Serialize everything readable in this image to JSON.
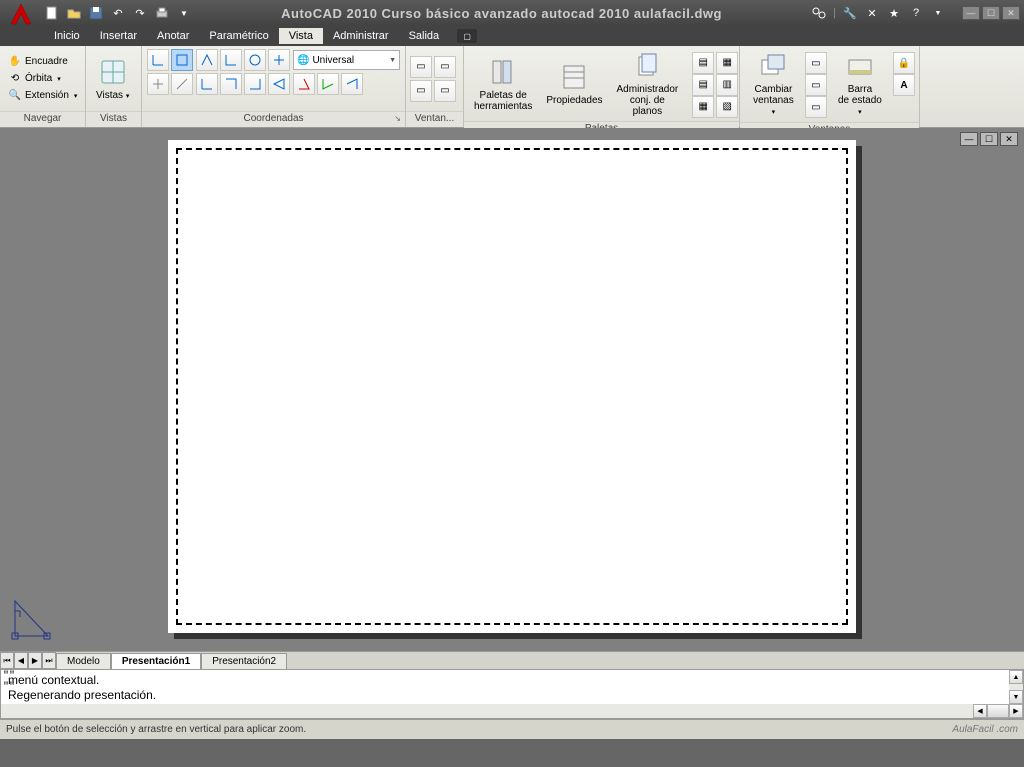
{
  "titlebar": {
    "title": "AutoCAD 2010   Curso básico avanzado autocad 2010 aulafacil.dwg"
  },
  "menu": {
    "items": [
      "Inicio",
      "Insertar",
      "Anotar",
      "Paramétrico",
      "Vista",
      "Administrar",
      "Salida"
    ],
    "active": "Vista"
  },
  "ribbon": {
    "navegar": {
      "title": "Navegar",
      "encuadre": "Encuadre",
      "orbita": "Órbita",
      "extension": "Extensión"
    },
    "vistas": {
      "title": "Vistas",
      "button": "Vistas"
    },
    "coordenadas": {
      "title": "Coordenadas",
      "combo": "Universal"
    },
    "ventan": {
      "title": "Ventan..."
    },
    "paletas": {
      "title": "Paletas",
      "paletas_de": "Paletas de",
      "herramientas": "herramientas",
      "propiedades": "Propiedades",
      "administrador": "Administrador",
      "conj": "conj. de planos"
    },
    "ventanas": {
      "title": "Ventanas",
      "cambiar": "Cambiar",
      "cambiar2": "ventanas",
      "barra": "Barra",
      "barra2": "de estado"
    }
  },
  "tabs": {
    "modelo": "Modelo",
    "p1": "Presentación1",
    "p2": "Presentación2"
  },
  "command": {
    "line1": "menú contextual.",
    "line2": "Regenerando presentación."
  },
  "status": {
    "text": "Pulse el botón de selección y arrastre en vertical para aplicar zoom.",
    "brand": "AulaFacil .com"
  }
}
